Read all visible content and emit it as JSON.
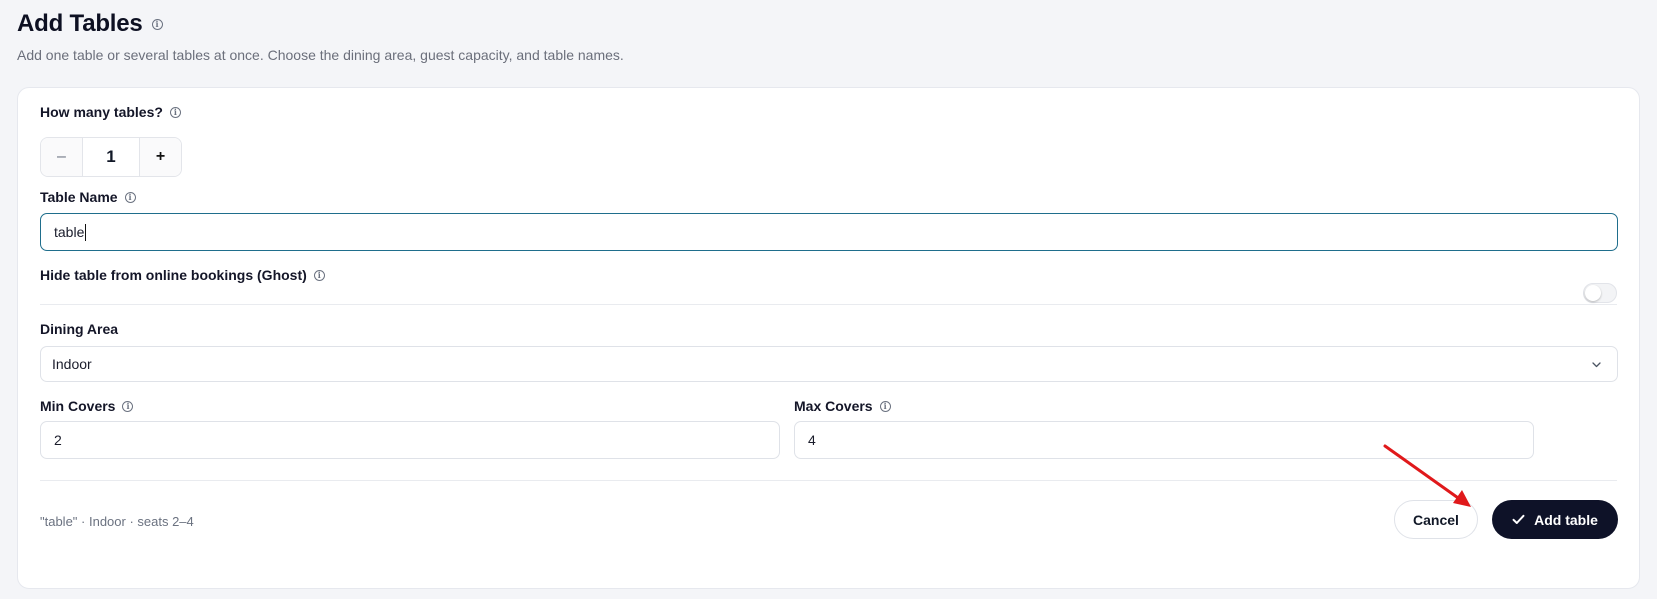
{
  "header": {
    "title": "Add Tables",
    "subtitle": "Add one table or several tables at once. Choose the dining area, guest capacity, and table names."
  },
  "form": {
    "count_label": "How many tables?",
    "count_value": "1",
    "minus_symbol": "–",
    "plus_symbol": "+",
    "table_name_label": "Table Name",
    "table_name_value": "table",
    "ghost_label": "Hide table from online bookings (Ghost)",
    "ghost_enabled": false,
    "dining_area_label": "Dining Area",
    "dining_area_value": "Indoor",
    "min_covers_label": "Min Covers",
    "min_covers_value": "2",
    "max_covers_label": "Max Covers",
    "max_covers_value": "4"
  },
  "footer": {
    "summary": "\"table\" · Indoor · seats 2–4",
    "cancel_label": "Cancel",
    "add_label": "Add table"
  },
  "icons": {
    "info": "info-icon",
    "chevron": "chevron-down-icon",
    "check": "check-icon",
    "annotation": "red-arrow-annotation"
  },
  "colors": {
    "primary": "#0e1228",
    "focus_border": "#1f6e8c",
    "annotation": "#e0191b"
  }
}
